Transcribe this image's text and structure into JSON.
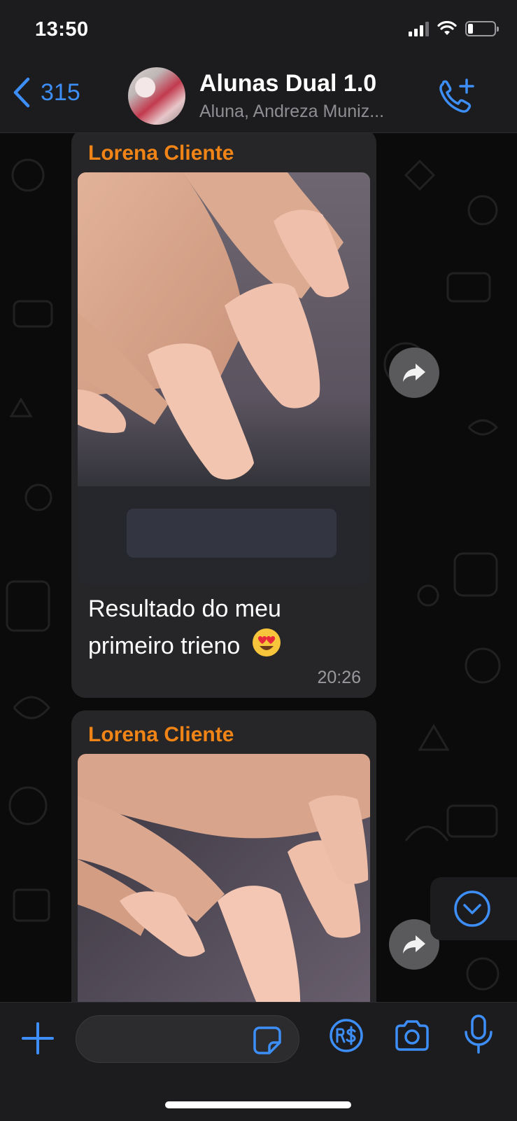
{
  "status_bar": {
    "time": "13:50",
    "battery_level": 0.2
  },
  "header": {
    "back_count": "315",
    "title": "Alunas Dual 1.0",
    "subtitle": "Aluna, Andreza Muniz...",
    "icons": {
      "back": "chevron-left-icon",
      "call": "phone-add-icon"
    }
  },
  "messages": [
    {
      "sender": "Lorena Cliente",
      "caption": "Resultado do meu primeiro trieno",
      "emoji": "heart-eyes-emoji",
      "time": "20:26",
      "image": "photo of matte nude long square nails"
    },
    {
      "sender": "Lorena Cliente",
      "image": "photo of matte nude long square nails"
    }
  ],
  "composer": {
    "placeholder": "",
    "icons": [
      "plus-icon",
      "sticker-icon",
      "payment-icon",
      "camera-icon",
      "microphone-icon"
    ]
  },
  "colors": {
    "accent_blue": "#3d8ef7",
    "sender_orange": "#f08416",
    "bubble": "#262628",
    "bar": "#1c1c1e"
  }
}
